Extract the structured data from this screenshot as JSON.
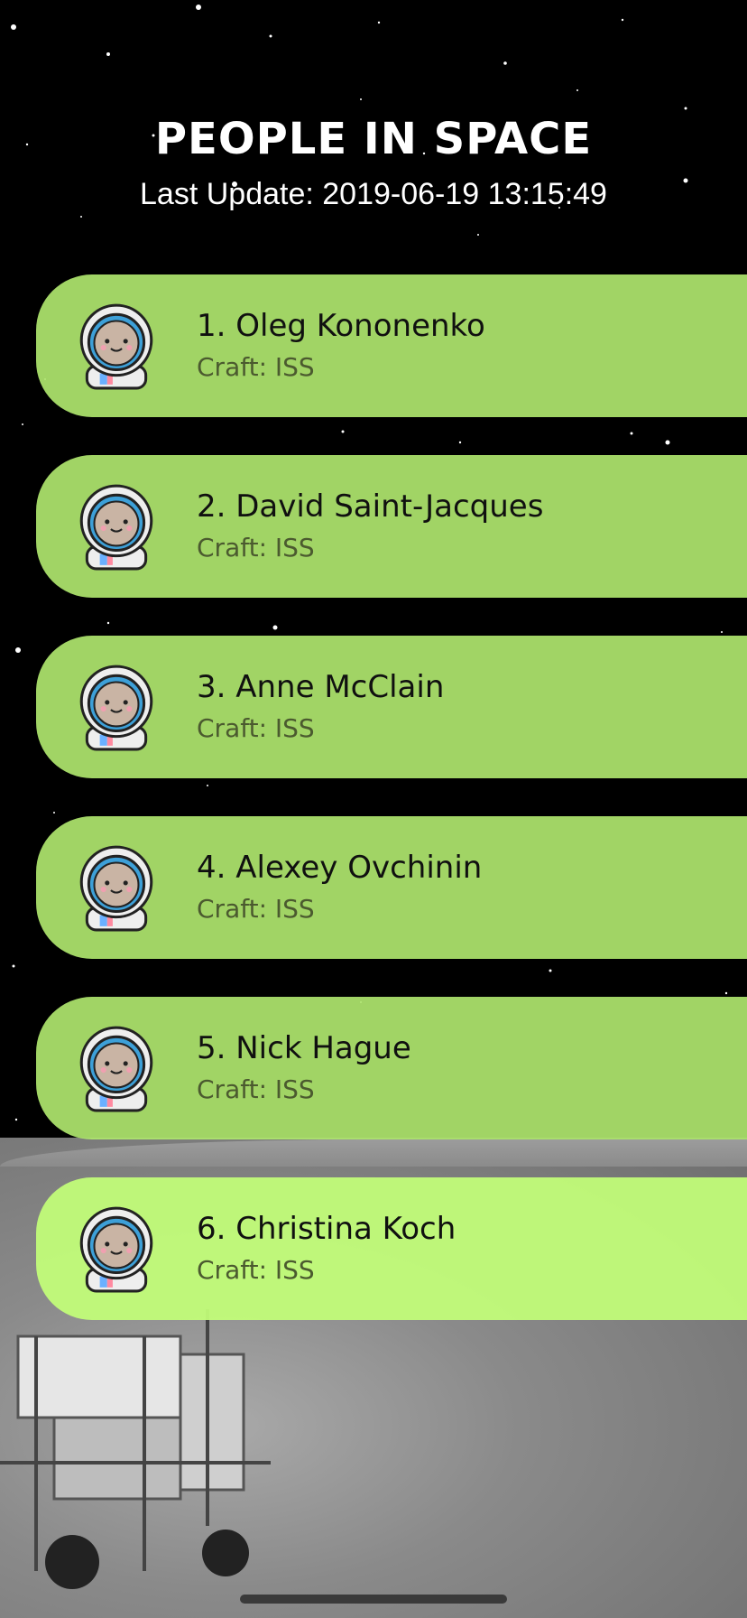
{
  "header": {
    "title": "PEOPLE IN SPACE",
    "last_update": "Last Update: 2019-06-19 13:15:49"
  },
  "people": [
    {
      "name": "1. Oleg Kononenko",
      "craft": "Craft: ISS"
    },
    {
      "name": "2. David Saint-Jacques",
      "craft": "Craft: ISS"
    },
    {
      "name": "3. Anne McClain",
      "craft": "Craft: ISS"
    },
    {
      "name": "4. Alexey Ovchinin",
      "craft": "Craft: ISS"
    },
    {
      "name": "5. Nick Hague",
      "craft": "Craft: ISS"
    },
    {
      "name": "6. Christina Koch",
      "craft": "Craft: ISS"
    }
  ],
  "colors": {
    "card_green": "#a8d870",
    "card_green_highlight": "#c3ff78",
    "background": "#000000"
  },
  "icons": {
    "avatar": "astronaut-icon"
  }
}
